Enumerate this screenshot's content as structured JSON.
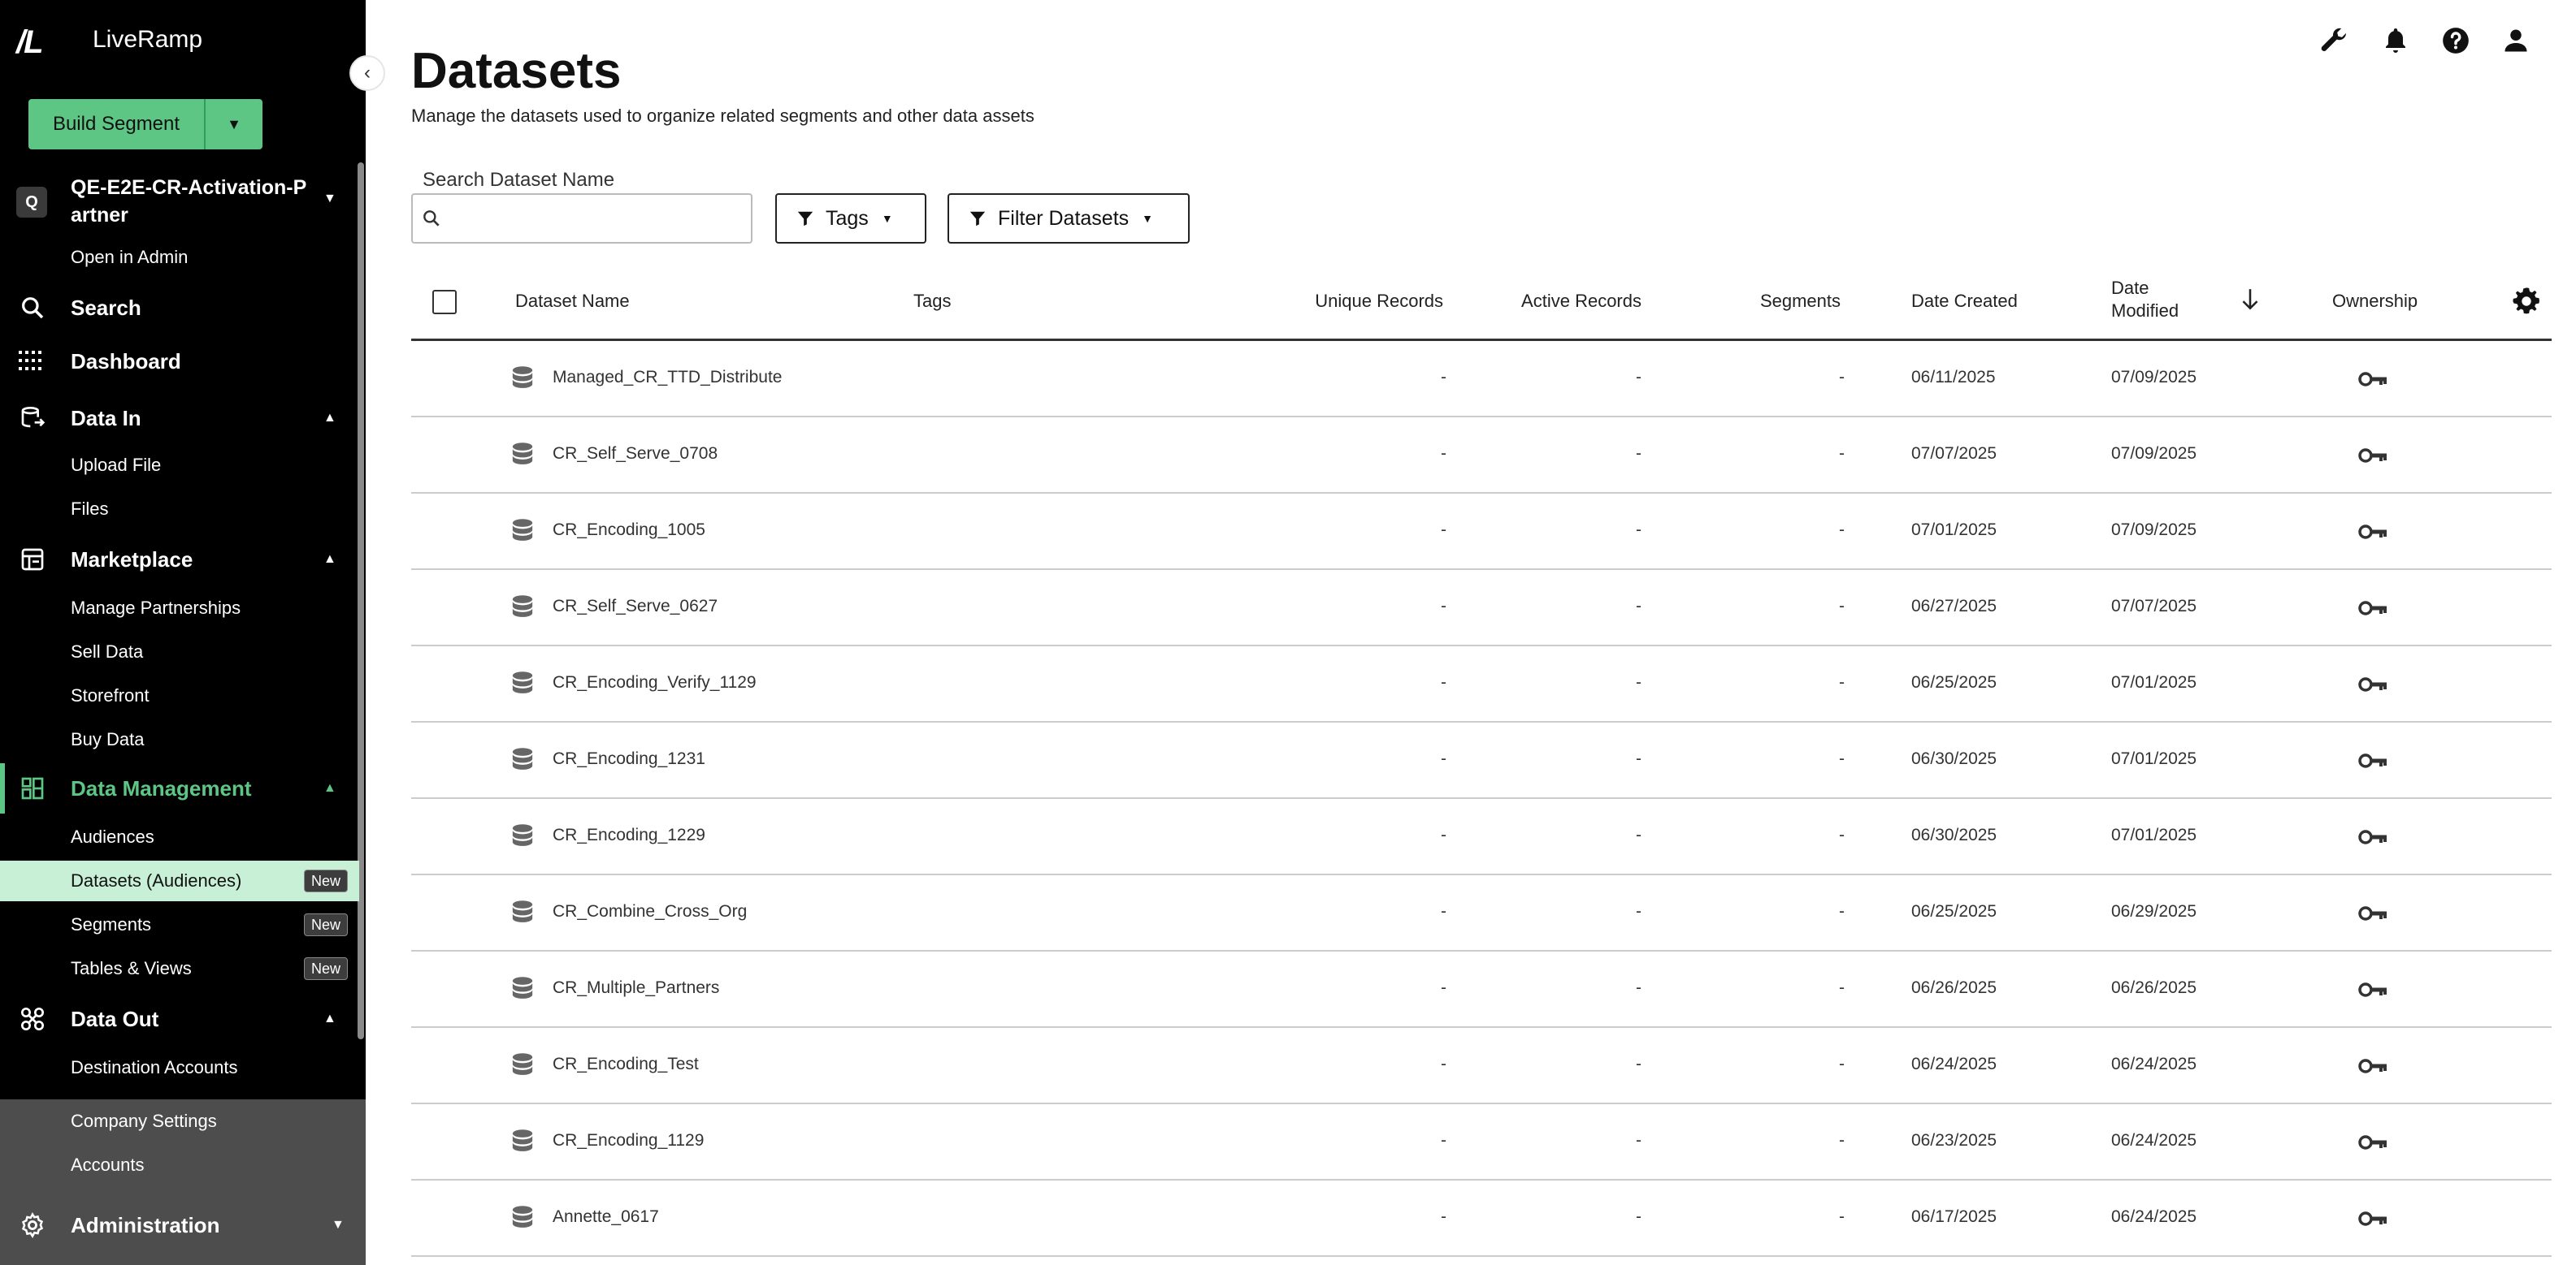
{
  "app": {
    "logo_mark": "/L",
    "name": "LiveRamp"
  },
  "sidebar": {
    "build_button": "Build Segment",
    "org": {
      "badge": "Q",
      "name": "QE-E2E-CR-Activation-Partner",
      "open_admin": "Open in Admin"
    },
    "search": "Search",
    "dashboard": "Dashboard",
    "data_in": {
      "label": "Data In",
      "items": [
        "Upload File",
        "Files"
      ]
    },
    "marketplace": {
      "label": "Marketplace",
      "items": [
        "Manage Partnerships",
        "Sell Data",
        "Storefront",
        "Buy Data"
      ]
    },
    "data_management": {
      "label": "Data Management",
      "items": [
        "Audiences",
        "Datasets (Audiences)",
        "Segments",
        "Tables & Views"
      ],
      "new_badge": "New"
    },
    "data_out": {
      "label": "Data Out",
      "items": [
        "Destination Accounts"
      ]
    },
    "lower_items": [
      "Company Settings",
      "Accounts"
    ],
    "administration": "Administration"
  },
  "main": {
    "title": "Datasets",
    "subtitle": "Manage the datasets used to organize related segments and other data assets",
    "search_label": "Search Dataset Name",
    "search_value": "",
    "tags_button": "Tags",
    "filter_button": "Filter Datasets",
    "columns": {
      "name": "Dataset Name",
      "tags": "Tags",
      "unique": "Unique Records",
      "active": "Active Records",
      "segments": "Segments",
      "created": "Date Created",
      "modified_line1": "Date",
      "modified_line2": "Modified",
      "ownership": "Ownership"
    },
    "rows": [
      {
        "name": "Managed_CR_TTD_Distribute",
        "tags": "",
        "unique": "-",
        "active": "-",
        "segments": "-",
        "created": "06/11/2025",
        "modified": "07/09/2025"
      },
      {
        "name": "CR_Self_Serve_0708",
        "tags": "",
        "unique": "-",
        "active": "-",
        "segments": "-",
        "created": "07/07/2025",
        "modified": "07/09/2025"
      },
      {
        "name": "CR_Encoding_1005",
        "tags": "",
        "unique": "-",
        "active": "-",
        "segments": "-",
        "created": "07/01/2025",
        "modified": "07/09/2025"
      },
      {
        "name": "CR_Self_Serve_0627",
        "tags": "",
        "unique": "-",
        "active": "-",
        "segments": "-",
        "created": "06/27/2025",
        "modified": "07/07/2025"
      },
      {
        "name": "CR_Encoding_Verify_1129",
        "tags": "",
        "unique": "-",
        "active": "-",
        "segments": "-",
        "created": "06/25/2025",
        "modified": "07/01/2025"
      },
      {
        "name": "CR_Encoding_1231",
        "tags": "",
        "unique": "-",
        "active": "-",
        "segments": "-",
        "created": "06/30/2025",
        "modified": "07/01/2025"
      },
      {
        "name": "CR_Encoding_1229",
        "tags": "",
        "unique": "-",
        "active": "-",
        "segments": "-",
        "created": "06/30/2025",
        "modified": "07/01/2025"
      },
      {
        "name": "CR_Combine_Cross_Org",
        "tags": "",
        "unique": "-",
        "active": "-",
        "segments": "-",
        "created": "06/25/2025",
        "modified": "06/29/2025"
      },
      {
        "name": "CR_Multiple_Partners",
        "tags": "",
        "unique": "-",
        "active": "-",
        "segments": "-",
        "created": "06/26/2025",
        "modified": "06/26/2025"
      },
      {
        "name": "CR_Encoding_Test",
        "tags": "",
        "unique": "-",
        "active": "-",
        "segments": "-",
        "created": "06/24/2025",
        "modified": "06/24/2025"
      },
      {
        "name": "CR_Encoding_1129",
        "tags": "",
        "unique": "-",
        "active": "-",
        "segments": "-",
        "created": "06/23/2025",
        "modified": "06/24/2025"
      },
      {
        "name": "Annette_0617",
        "tags": "",
        "unique": "-",
        "active": "-",
        "segments": "-",
        "created": "06/17/2025",
        "modified": "06/24/2025"
      }
    ]
  },
  "colors": {
    "accent": "#5ec684",
    "sidebar_bg": "#000000",
    "sidebar_lower_bg": "#4d4d4d",
    "active_row": "#c8f0d6"
  }
}
